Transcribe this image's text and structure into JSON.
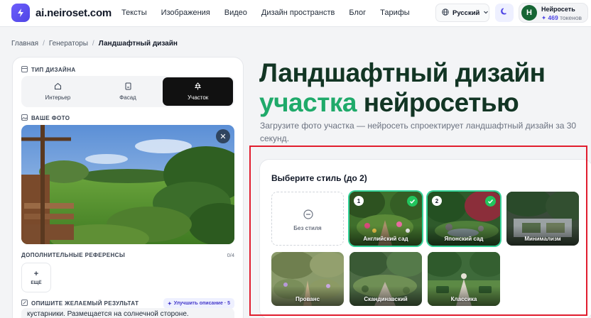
{
  "header": {
    "logo_text": "ai.neiroset.com",
    "nav": [
      "Тексты",
      "Изображения",
      "Видео",
      "Дизайн пространств",
      "Блог",
      "Тарифы"
    ],
    "language": "Русский",
    "user": {
      "initial": "H",
      "name": "Нейросеть",
      "tokens_value": "469",
      "tokens_label": "токенов"
    }
  },
  "breadcrumb": {
    "items": [
      "Главная",
      "Генераторы"
    ],
    "current": "Ландшафтный дизайн"
  },
  "left": {
    "type_label": "ТИП ДИЗАЙНА",
    "tabs": [
      {
        "label": "Интерьер",
        "icon": "home-icon"
      },
      {
        "label": "Фасад",
        "icon": "facade-icon"
      },
      {
        "label": "Участок",
        "icon": "tree-icon"
      }
    ],
    "active_tab": "Участок",
    "photo_label": "ВАШЕ ФОТО",
    "refs_label": "ДОПОЛНИТЕЛЬНЫЕ РЕФЕРЕНСЫ",
    "refs_count": "0/4",
    "add_label": "ЕЩЁ",
    "desc_label": "ОПИШИТЕ ЖЕЛАЕМЫЙ РЕЗУЛЬТАТ",
    "improve_label": "Улучшить описание · 5",
    "desc_text": "кустарники. Размещается на солнечной стороне."
  },
  "hero": {
    "title_line1": "Ландшафтный дизайн",
    "title_accent": "участка",
    "title_rest": "нейросетью",
    "subtitle": "Загрузите фото участка — нейросеть спроектирует ландшафтный дизайн за 30 секунд."
  },
  "styles": {
    "title": "Выберите стиль (до 2)",
    "items": [
      {
        "label": "Без стиля",
        "selected": false
      },
      {
        "label": "Английский сад",
        "selected": true,
        "order": "1"
      },
      {
        "label": "Японский сад",
        "selected": true,
        "order": "2"
      },
      {
        "label": "Минимализм",
        "selected": false
      },
      {
        "label": "Прованс",
        "selected": false
      },
      {
        "label": "Скандинавский",
        "selected": false
      },
      {
        "label": "Классика",
        "selected": false
      }
    ]
  },
  "colors": {
    "accent": "#4f46e5",
    "brand_green": "#1faa6a",
    "title_dark": "#123524",
    "highlight": "#e11d2e"
  }
}
